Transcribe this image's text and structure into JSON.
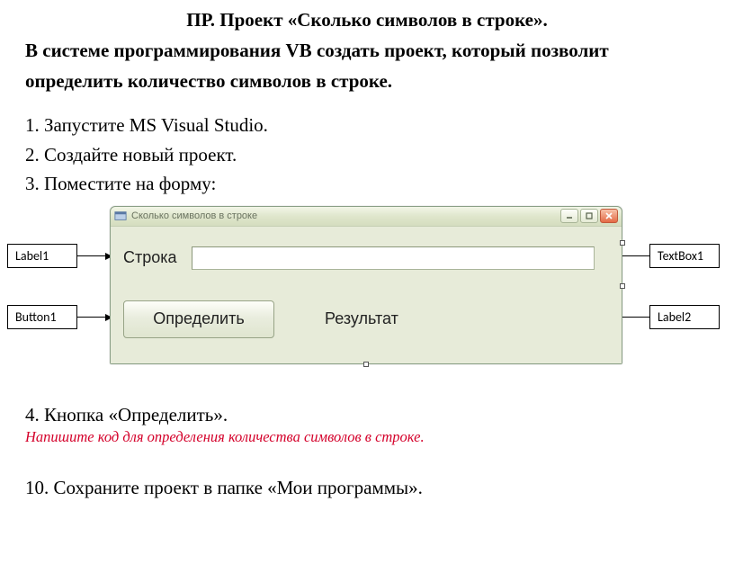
{
  "title": "ПР. Проект «Сколько символов в строке».",
  "subtitle": "В системе программирования VB создать проект, который позволит определить количество символов в строке.",
  "steps": {
    "s1": "1. Запустите MS Visual Studio.",
    "s2": "2. Создайте новый проект.",
    "s3": "3. Поместите на форму:"
  },
  "callouts": {
    "label1": "Label1",
    "button1": "Button1",
    "textbox1": "TextBox1",
    "label2": "Label2"
  },
  "window": {
    "title": "Сколько символов в строке",
    "label1": "Строка",
    "label2": "Результат",
    "button": "Определить",
    "textbox_value": ""
  },
  "step4": "4. Кнопка «Определить».",
  "red_instruction": "Напишите код для определения количества символов в строке.",
  "step10": "10. Сохраните проект в папке «Мои программы»."
}
